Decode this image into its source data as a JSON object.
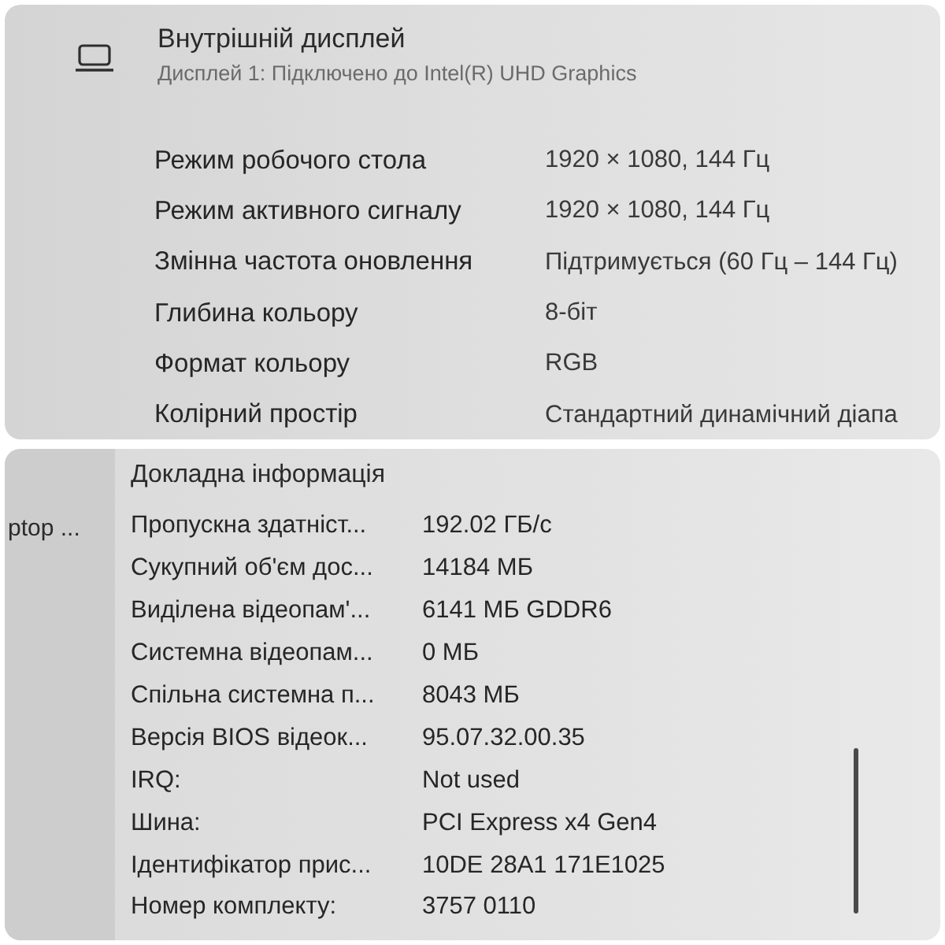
{
  "display_panel": {
    "title": "Внутрішній дисплей",
    "subtitle": "Дисплей 1: Підключено до Intel(R) UHD Graphics",
    "rows": [
      {
        "label": "Режим робочого стола",
        "value": "1920 × 1080, 144 Гц"
      },
      {
        "label": "Режим активного сигналу",
        "value": "1920 × 1080, 144 Гц"
      },
      {
        "label": "Змінна частота оновлення",
        "value": "Підтримується (60 Гц – 144 Гц)"
      },
      {
        "label": "Глибина кольору",
        "value": "8-біт"
      },
      {
        "label": "Формат кольору",
        "value": "RGB"
      },
      {
        "label": "Колірний простір",
        "value": "Стандартний динамічний діапа"
      }
    ]
  },
  "adapter_panel": {
    "sidebar_item": "ptop ...",
    "heading": "Докладна інформація",
    "rows": [
      {
        "label": "Пропускна здатніст...",
        "value": "192.02 ГБ/с"
      },
      {
        "label": "Сукупний об'єм дос...",
        "value": "14184 МБ"
      },
      {
        "label": "Виділена відеопам'...",
        "value": "6141 МБ GDDR6"
      },
      {
        "label": "Системна відеопам...",
        "value": "0 МБ"
      },
      {
        "label": "Спільна системна п...",
        "value": "8043 МБ"
      },
      {
        "label": "Версія BIOS відеок...",
        "value": "95.07.32.00.35"
      },
      {
        "label": "IRQ:",
        "value": "Not used"
      },
      {
        "label": "Шина:",
        "value": "PCI Express x4 Gen4"
      },
      {
        "label": "Ідентифікатор прис...",
        "value": "10DE 28A1 171E1025"
      },
      {
        "label": "Номер комплекту:",
        "value": "3757 0110"
      }
    ]
  }
}
